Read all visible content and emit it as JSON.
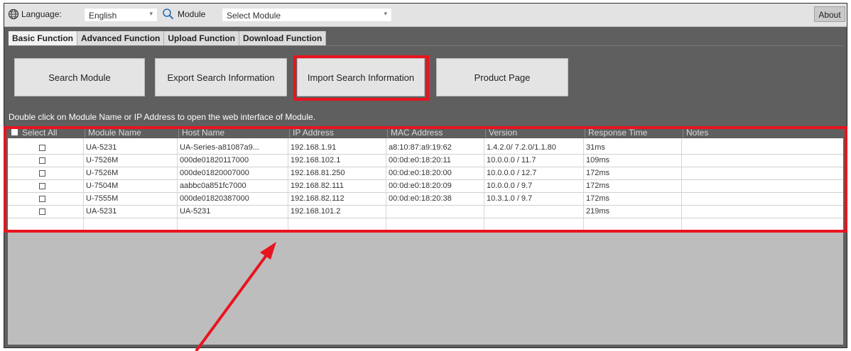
{
  "topbar": {
    "language_label": "Language:",
    "language_value": "English",
    "module_label": "Module",
    "module_value": "Select Module",
    "about_label": "About"
  },
  "tabs": [
    {
      "label": "Basic Function",
      "active": true
    },
    {
      "label": "Advanced Function",
      "active": false
    },
    {
      "label": "Upload Function",
      "active": false
    },
    {
      "label": "Download Function",
      "active": false
    }
  ],
  "buttons": {
    "search_module": "Search Module",
    "export_search": "Export Search Information",
    "import_search": "Import Search Information",
    "product_page": "Product Page"
  },
  "hint": "Double click on Module Name or IP Address to open the web interface of Module.",
  "table": {
    "headers": [
      "Select All",
      "Module Name",
      "Host Name",
      "IP Address",
      "MAC Address",
      "Version",
      "Response Time",
      "Notes"
    ],
    "rows": [
      {
        "module": "UA-5231",
        "host": "UA-Series-a81087a9...",
        "ip": "192.168.1.91",
        "mac": "a8:10:87:a9:19:62",
        "version": "1.4.2.0/ 7.2.0/1.1.80",
        "response": "31ms",
        "notes": ""
      },
      {
        "module": "U-7526M",
        "host": "000de01820117000",
        "ip": "192.168.102.1",
        "mac": "00:0d:e0:18:20:11",
        "version": "10.0.0.0 / 11.7",
        "response": "109ms",
        "notes": ""
      },
      {
        "module": "U-7526M",
        "host": "000de01820007000",
        "ip": "192.168.81.250",
        "mac": "00:0d:e0:18:20:00",
        "version": "10.0.0.0 / 12.7",
        "response": "172ms",
        "notes": ""
      },
      {
        "module": "U-7504M",
        "host": "aabbc0a851fc7000",
        "ip": "192.168.82.111",
        "mac": "00:0d:e0:18:20:09",
        "version": "10.0.0.0 / 9.7",
        "response": "172ms",
        "notes": ""
      },
      {
        "module": "U-7555M",
        "host": "000de01820387000",
        "ip": "192.168.82.112",
        "mac": "00:0d:e0:18:20:38",
        "version": "10.3.1.0 / 9.7",
        "response": "172ms",
        "notes": ""
      },
      {
        "module": "UA-5231",
        "host": "UA-5231",
        "ip": "192.168.101.2",
        "mac": "",
        "version": "",
        "response": "219ms",
        "notes": ""
      }
    ]
  },
  "colors": {
    "highlight": "#e8141e",
    "panel": "#5f5f5f",
    "empty_area": "#bdbdbd"
  }
}
